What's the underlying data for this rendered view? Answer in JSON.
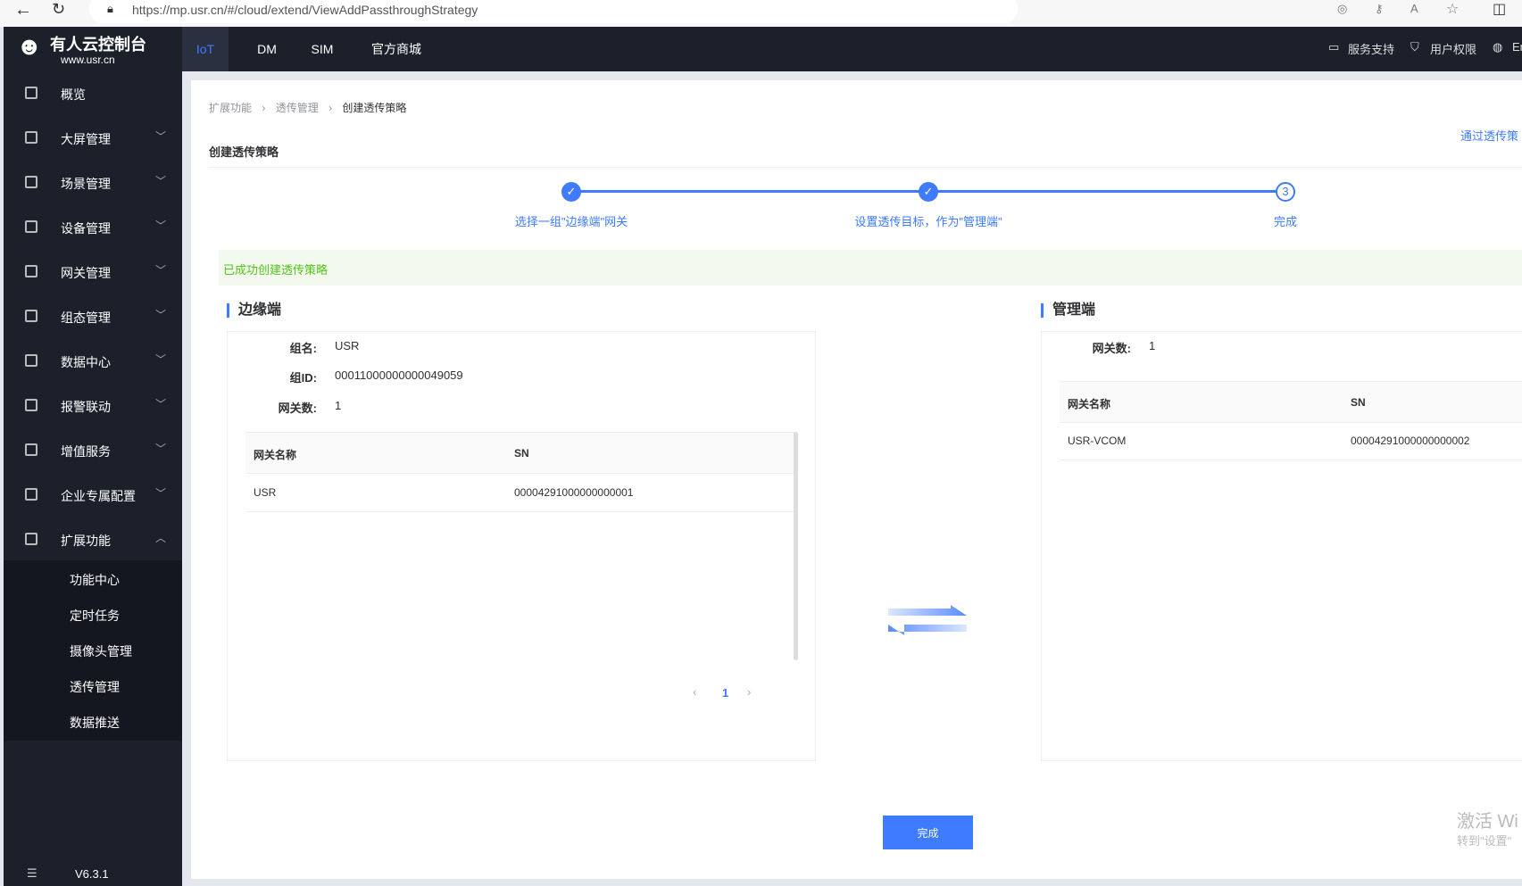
{
  "browser": {
    "url": "https://mp.usr.cn/#/cloud/extend/ViewAddPassthroughStrategy"
  },
  "brand": {
    "name": "有人云控制台",
    "site": "www.usr.cn"
  },
  "topnav": {
    "tabs": [
      "IoT",
      "DM",
      "SIM",
      "官方商城"
    ],
    "active": "IoT",
    "right": [
      "服务支持",
      "用户权限",
      "En"
    ]
  },
  "sidebar": {
    "items": [
      "概览",
      "大屏管理",
      "场景管理",
      "设备管理",
      "网关管理",
      "组态管理",
      "数据中心",
      "报警联动",
      "增值服务",
      "企业专属配置",
      "扩展功能"
    ],
    "submenu": [
      "功能中心",
      "定时任务",
      "摄像头管理",
      "透传管理",
      "数据推送"
    ],
    "version": "V6.3.1"
  },
  "breadcrumb": [
    "扩展功能",
    "透传管理",
    "创建透传策略"
  ],
  "page": {
    "title": "创建透传策略",
    "top_link": "通过透传策"
  },
  "steps": [
    {
      "label": "选择一组\"边缘端\"网关",
      "status": "done"
    },
    {
      "label": "设置透传目标，作为\"管理端\"",
      "status": "done"
    },
    {
      "label": "完成",
      "num": "3",
      "status": "current"
    }
  ],
  "success_msg": "已成功创建透传策略",
  "edge": {
    "title": "边缘端",
    "group_name_label": "组名:",
    "group_name": "USR",
    "group_id_label": "组ID:",
    "group_id": "00011000000000049059",
    "count_label": "网关数:",
    "count": "1",
    "columns": [
      "网关名称",
      "SN"
    ],
    "rows": [
      [
        "USR",
        "00004291000000000001"
      ]
    ],
    "page": "1"
  },
  "manager": {
    "title": "管理端",
    "count_label": "网关数:",
    "count": "1",
    "columns": [
      "网关名称",
      "SN"
    ],
    "rows": [
      [
        "USR-VCOM",
        "00004291000000000002"
      ]
    ]
  },
  "finish_button": "完成",
  "watermark": {
    "line1": "激活 Wi",
    "line2": "转到\"设置\""
  },
  "colors": {
    "accent": "#3e7bff",
    "success": "#52c41a",
    "sidebar": "#1c202b"
  }
}
